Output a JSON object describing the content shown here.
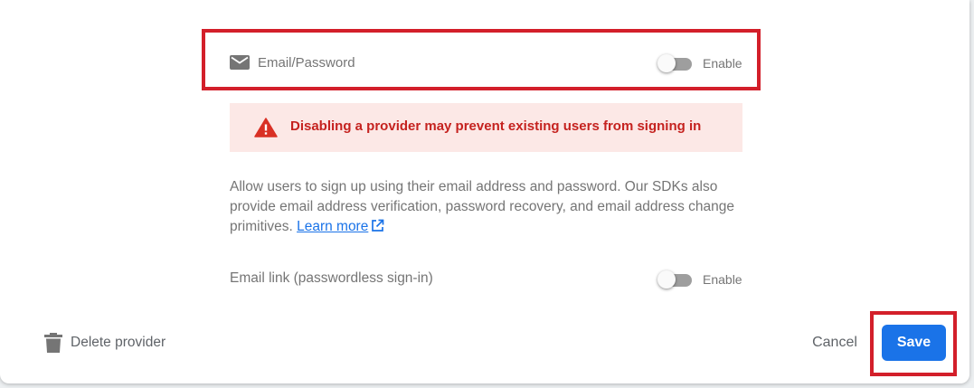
{
  "provider": {
    "name": "Email/Password",
    "enabled": false,
    "toggle_label": "Enable"
  },
  "warning": {
    "text": "Disabling a provider may prevent existing users from signing in"
  },
  "description": {
    "text": "Allow users to sign up using their email address and password. Our SDKs also provide email address verification, password recovery, and email address change primitives. ",
    "link_label": "Learn more"
  },
  "email_link": {
    "label": "Email link (passwordless sign-in)",
    "enabled": false,
    "toggle_label": "Enable"
  },
  "footer": {
    "delete_label": "Delete provider",
    "cancel_label": "Cancel",
    "save_label": "Save"
  },
  "colors": {
    "primary": "#1a73e8",
    "warning_bg": "#fce8e6",
    "warning_text": "#c5221f",
    "highlight": "#d31f2a"
  },
  "icons": {
    "provider": "mail-icon",
    "warning": "warning-icon",
    "external_link": "external-link-icon",
    "delete": "trash-icon"
  }
}
